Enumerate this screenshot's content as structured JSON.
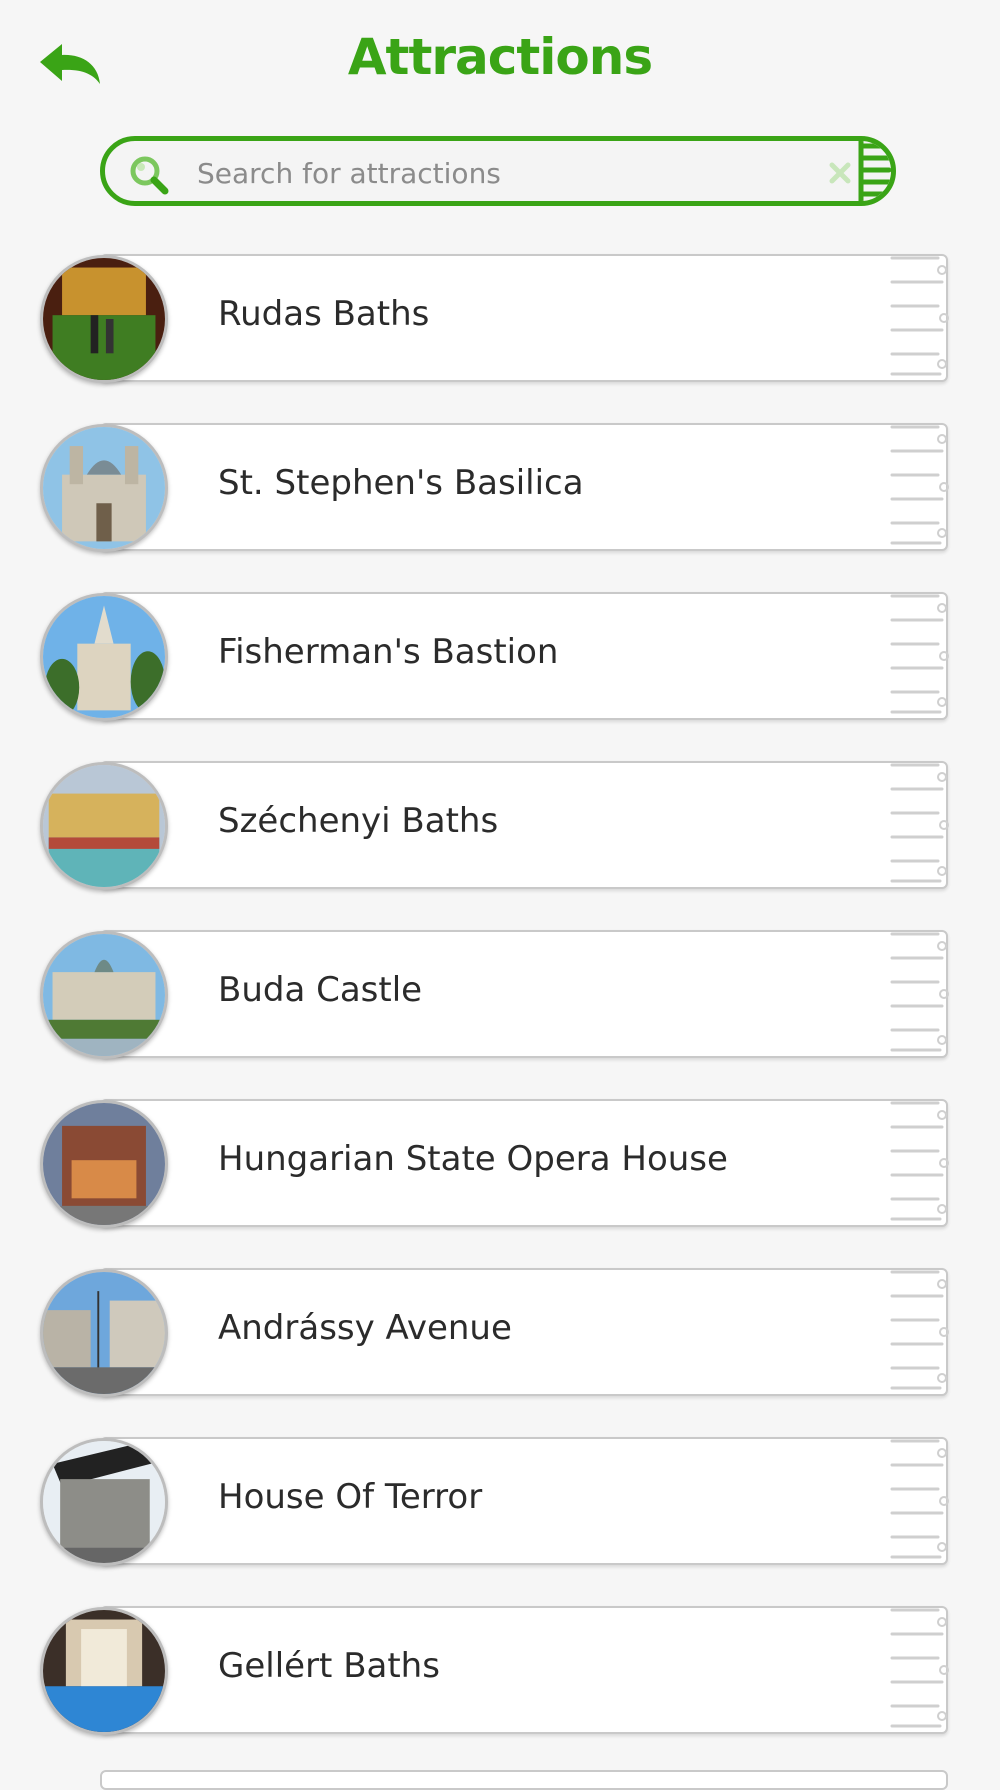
{
  "header": {
    "title": "Attractions",
    "back_icon": "back-arrow-icon"
  },
  "search": {
    "value": "",
    "placeholder": "Search for attractions",
    "search_icon": "magnifier-icon",
    "clear_icon": "clear-x-icon"
  },
  "attractions": [
    {
      "label": "Rudas Baths",
      "thumb": "bath-hall-photo"
    },
    {
      "label": "St. Stephen's Basilica",
      "thumb": "basilica-photo"
    },
    {
      "label": "Fisherman's Bastion",
      "thumb": "bastion-photo"
    },
    {
      "label": "Széchenyi Baths",
      "thumb": "outdoor-bath-photo"
    },
    {
      "label": "Buda Castle",
      "thumb": "castle-photo"
    },
    {
      "label": "Hungarian State Opera House",
      "thumb": "opera-house-photo"
    },
    {
      "label": "Andrássy Avenue",
      "thumb": "avenue-photo"
    },
    {
      "label": "House Of Terror",
      "thumb": "terror-house-photo"
    },
    {
      "label": "Gellért Baths",
      "thumb": "indoor-pool-photo"
    }
  ],
  "colors": {
    "accent": "#3aa416",
    "background": "#f6f6f6",
    "card_border": "#c9c9c9",
    "text": "#2b2b2b"
  }
}
